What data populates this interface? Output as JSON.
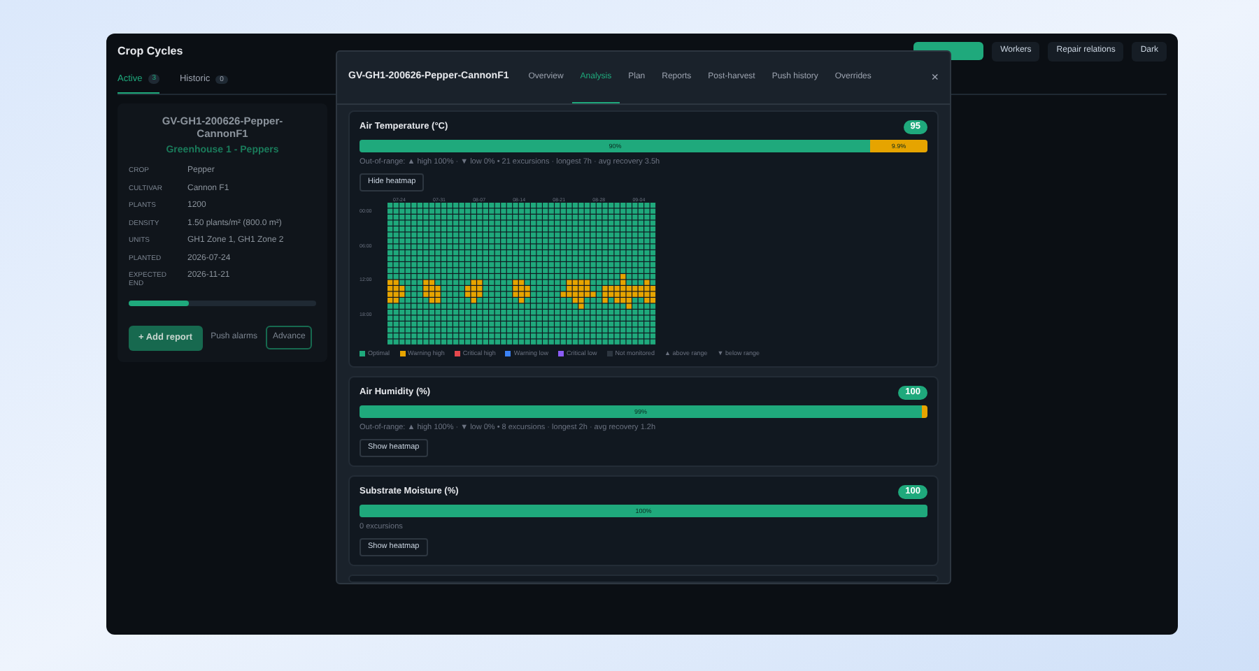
{
  "app": {
    "title": "Crop Cycles",
    "toolbar": [
      "Workers",
      "Repair relations",
      "Dark"
    ],
    "tabs": [
      {
        "label": "Active",
        "count": "3",
        "selected": true
      },
      {
        "label": "Historic",
        "count": "0",
        "selected": false
      }
    ],
    "card": {
      "title": "GV-GH1-200626-Pepper-CannonF1",
      "subtitle": "Greenhouse 1 - Peppers",
      "fields": [
        {
          "label": "CROP",
          "value": "Pepper"
        },
        {
          "label": "CULTIVAR",
          "value": "Cannon F1"
        },
        {
          "label": "PLANTS",
          "value": "1200"
        },
        {
          "label": "DENSITY",
          "value": "1.50 plants/m² (800.0 m²)"
        },
        {
          "label": "UNITS",
          "value": "GH1 Zone 1, GH1 Zone 2"
        },
        {
          "label": "PLANTED",
          "value": "2026-07-24"
        },
        {
          "label": "EXPECTED END",
          "value": "2026-11-21"
        }
      ],
      "progress": {
        "level": 0.32
      },
      "add_button": "+ Add report",
      "push_label": "Push alarms",
      "advance_select": "Advance"
    }
  },
  "modal": {
    "title": "GV-GH1-200626-Pepper-CannonF1",
    "tabs": [
      {
        "label": "Overview",
        "selected": false
      },
      {
        "label": "Analysis",
        "selected": true
      },
      {
        "label": "Plan",
        "selected": false
      },
      {
        "label": "Reports",
        "selected": false
      },
      {
        "label": "Post-harvest",
        "selected": false
      },
      {
        "label": "Push history",
        "selected": false
      },
      {
        "label": "Overrides",
        "selected": false
      }
    ],
    "close": "×",
    "sections": [
      {
        "title": "Air Temperature (°C)",
        "score": "95",
        "segments": [
          {
            "kind": "ok",
            "level": 0.9,
            "label": "90%"
          },
          {
            "kind": "warn",
            "level": 0.099,
            "label": "9.9%"
          }
        ],
        "summary": "Out-of-range: ▲ high 100% · ▼ low 0% • 21 excursions · longest 7h · avg recovery 3.5h",
        "toggle": "Hide heatmap",
        "heatmap": {
          "expanded": true,
          "x_labels": [
            "07-24",
            "07-31",
            "08-07",
            "08-14",
            "08-21",
            "08-28",
            "09-04"
          ],
          "y_labels": [
            "00:00",
            "06:00",
            "12:00",
            "18:00"
          ],
          "legend": [
            {
              "label": "Optimal",
              "color": "#1fa97c"
            },
            {
              "label": "Warning high",
              "color": "#e6a400"
            },
            {
              "label": "Critical high",
              "color": "#e5484d"
            },
            {
              "label": "Warning low",
              "color": "#3b82f6"
            },
            {
              "label": "Critical low",
              "color": "#8b5cf6"
            },
            {
              "label": "Not monitored",
              "color": "#2d3640"
            },
            {
              "label": "▲ above range"
            },
            {
              "label": "▼ below range"
            }
          ]
        }
      },
      {
        "title": "Air Humidity (%)",
        "score": "100",
        "segments": [
          {
            "kind": "ok",
            "level": 0.99,
            "label": "99%"
          },
          {
            "kind": "warn",
            "level": 0.01
          }
        ],
        "summary": "Out-of-range: ▲ high 100% · ▼ low 0% • 8 excursions · longest 2h · avg recovery 1.2h",
        "toggle": "Show heatmap"
      },
      {
        "title": "Substrate Moisture (%)",
        "score": "100",
        "segments": [
          {
            "kind": "ok",
            "level": 1,
            "label": "100%"
          }
        ],
        "summary": "0 excursions",
        "toggle": "Show heatmap"
      }
    ]
  }
}
